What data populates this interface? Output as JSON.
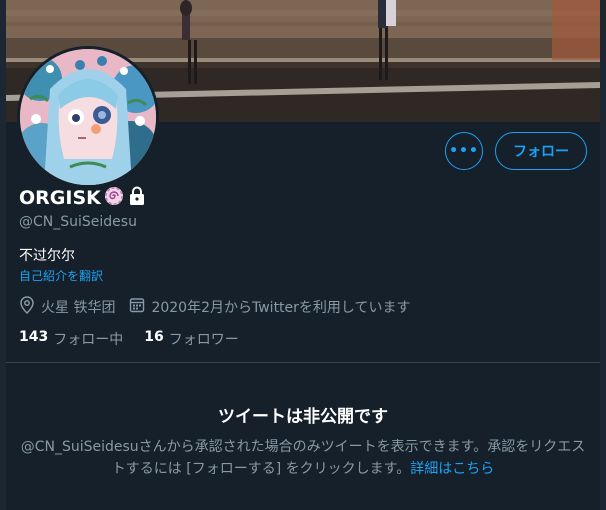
{
  "profile": {
    "display_name": "ORGISK",
    "handle": "@CN_SuiSeidesu",
    "bio": "不过尔尔",
    "translate_bio": "自己紹介を翻訳",
    "location": "火星 铁华团",
    "joined": "2020年2月からTwitterを利用しています",
    "following_count": "143",
    "following_label": "フォロー中",
    "followers_count": "16",
    "followers_label": "フォロワー"
  },
  "actions": {
    "more_label": "•••",
    "follow_label": "フォロー"
  },
  "private_notice": {
    "title": "ツイートは非公開です",
    "body": "@CN_SuiSeidesuさんから承認された場合のみツイートを表示できます。承認をリクエストするには [フォローする] をクリックします。",
    "link": "詳細はこちら"
  },
  "icons": {
    "badge": "spiral-emoji-icon",
    "lock": "lock-icon",
    "location": "location-pin-icon",
    "calendar": "calendar-icon"
  },
  "colors": {
    "background": "#15202b",
    "accent": "#1da1f2",
    "secondary_text": "#8899a6",
    "divider": "#38444d"
  }
}
